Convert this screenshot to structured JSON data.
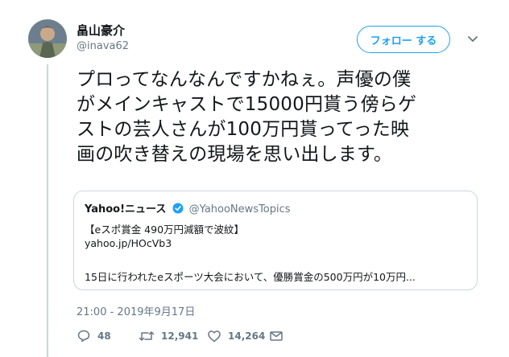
{
  "author": {
    "name": "畠山豪介",
    "handle": "@inava62"
  },
  "follow_label": "フォロー する",
  "tweet_text": "プロってなんなんですかねぇ。声優の僕\nがメインキャストで15000円貰う傍らゲ\nストの芸人さんが100万円貰ってった映\n画の吹き替えの現場を思い出します。",
  "quote": {
    "name": "Yahoo!ニュース",
    "handle": "@YahooNewsTopics",
    "headline": "【eスポ賞金 490万円減額で波紋】",
    "link": "yahoo.jp/HOcVb3",
    "summary": "15日に行われたeスポーツ大会において、優勝賞金の500万円が10万円..."
  },
  "timestamp": "21:00 - 2019年9月17日",
  "stats": {
    "replies": "48",
    "retweets": "12,941",
    "likes": "14,264"
  },
  "colors": {
    "accent": "#1da1f2",
    "muted": "#657786",
    "border": "#ccd6dd"
  }
}
